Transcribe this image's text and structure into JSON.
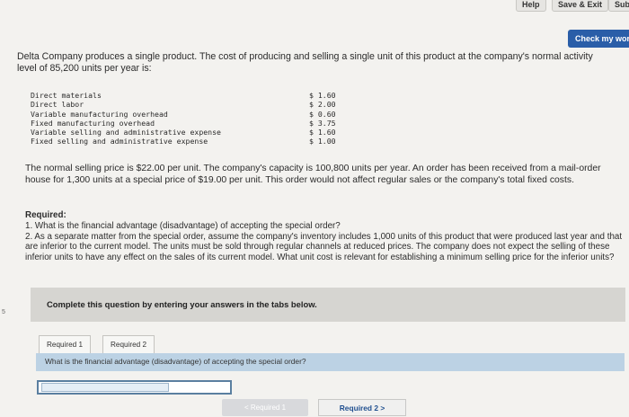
{
  "topbar": {
    "help_label": "Help",
    "save_exit_label": "Save & Exit",
    "submit_label": "Sub"
  },
  "check_work_label": "Check my wor",
  "intro_text": "Delta Company produces a single product. The cost of producing and selling a single unit of this product at the company's normal activity level of 85,200 units per year is:",
  "cost_table": [
    {
      "label": "Direct materials",
      "value": "$ 1.60"
    },
    {
      "label": "Direct labor",
      "value": "$ 2.00"
    },
    {
      "label": "Variable manufacturing overhead",
      "value": "$ 0.60"
    },
    {
      "label": "Fixed manufacturing overhead",
      "value": "$ 3.75"
    },
    {
      "label": "Variable selling and administrative expense",
      "value": "$ 1.60"
    },
    {
      "label": "Fixed selling and administrative expense",
      "value": "$ 1.00"
    }
  ],
  "selling_text": "The normal selling price is $22.00 per unit. The company's capacity is 100,800 units per year. An order has been received from a mail-order house for 1,300 units at a special price of $19.00 per unit. This order would not affect regular sales or the company's total fixed costs.",
  "required": {
    "heading": "Required:",
    "item1": "1. What is the financial advantage (disadvantage) of accepting the special order?",
    "item2": "2. As a separate matter from the special order, assume the company's inventory includes 1,000 units of this product that were produced last year and that are inferior to the current model. The units must be sold through regular channels at reduced prices. The company does not expect the selling of these inferior units to have any effect on the sales of its current model. What unit cost is relevant for establishing a minimum selling price for the inferior units?"
  },
  "instructions": "Complete this question by entering your answers in the tabs below.",
  "tabs": [
    {
      "label": "Required 1"
    },
    {
      "label": "Required 2"
    }
  ],
  "question_text": "What is the financial advantage (disadvantage) of accepting the special order?",
  "answer_value": "",
  "nav": {
    "prev_label": "< Required 1",
    "next_label": "Required 2 >"
  },
  "left_marker": "5"
}
